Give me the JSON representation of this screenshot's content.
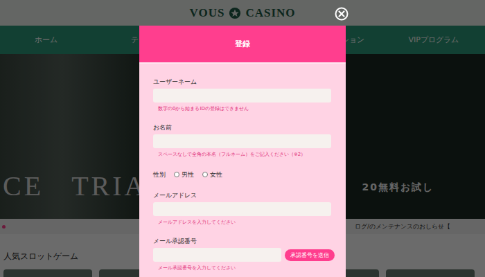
{
  "header": {
    "logo": [
      "VOUS",
      "CASINO"
    ]
  },
  "nav": {
    "left": [
      "ホーム",
      "テ"
    ],
    "right": [
      "ション",
      "VIPプログラム"
    ]
  },
  "hero": {
    "title": [
      "CE",
      "TRIAL"
    ],
    "caption": "20無料お試し"
  },
  "ticker": {
    "text": "ログ/のメンテナンスのおしらせ【"
  },
  "section": {
    "title": "人気スロットゲーム"
  },
  "modal": {
    "title": "登録",
    "fields": [
      {
        "kind": "text",
        "label": "ユーザーネーム",
        "value": "",
        "hint": "数字の0から始まるIDの登録はできません"
      },
      {
        "kind": "text",
        "label": "お名前",
        "value": "",
        "hint": "スペースなしで全角の本名（フルネーム）をご記入ください（※2）"
      },
      {
        "kind": "radio",
        "label": "性別",
        "options": [
          {
            "label": "男性",
            "selected": false
          },
          {
            "label": "女性",
            "selected": false
          }
        ]
      },
      {
        "kind": "text",
        "label": "メールアドレス",
        "value": "",
        "hint": "メールアドレスを入力してください"
      },
      {
        "kind": "code",
        "label": "メール承認番号",
        "value": "",
        "button": "承認番号を送信",
        "hint": "メール承認番号を入力してください"
      }
    ]
  }
}
